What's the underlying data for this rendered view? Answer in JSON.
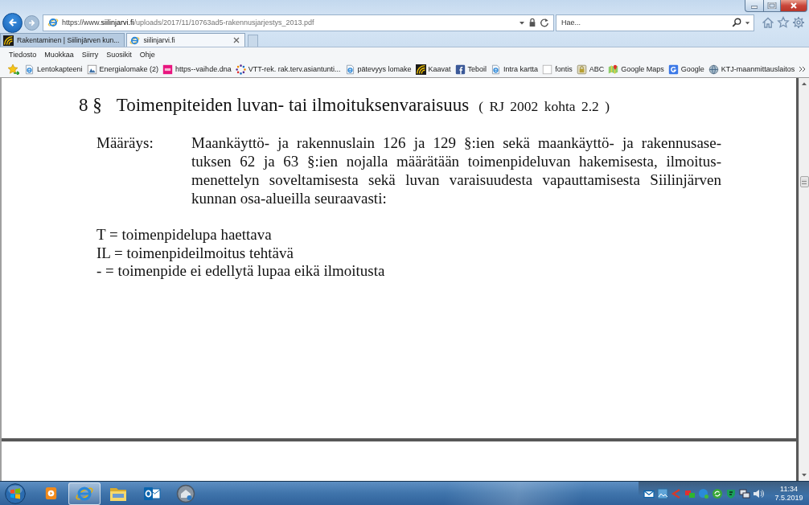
{
  "address_bar": {
    "prefix": "https://www.",
    "domain": "siilinjarvi.fi",
    "path": "/uploads/2017/11/10763ad5-rakennusjarjestys_2013.pdf"
  },
  "search": {
    "placeholder": "Hae..."
  },
  "tabs": [
    {
      "label": "Rakentaminen | Siilinjärven kun...",
      "selected": false
    },
    {
      "label": "siilinjarvi.fi",
      "selected": true
    }
  ],
  "menu": [
    "Tiedosto",
    "Muokkaa",
    "Siirry",
    "Suosikit",
    "Ohje"
  ],
  "favorites": [
    "Lentokapteeni",
    "Energialomake (2)",
    "https--vaihde.dna",
    "VTT-rek. rak.terv.asiantunti...",
    "pätevyys lomake",
    "Kaavat",
    "Teboil",
    "Intra kartta",
    "fontis",
    "ABC",
    "Google Maps",
    "Google",
    "KTJ-maanmittauslaitos"
  ],
  "document": {
    "section_number": "8 §",
    "title": "Toimenpiteiden luvan- tai ilmoituksenvaraisuus",
    "reference": "( RJ 2002 kohta 2.2 )",
    "regulation": {
      "label": "Määräys:",
      "lines": [
        "Maankäyttö- ja rakennuslain 126 ja 129 §:ien sekä maankäyttö- ja rakennusase-",
        "tuksen 62 ja 63 §:ien nojalla määrätään toimenpideluvan hakemisesta, ilmoitus-",
        "menettelyn soveltamisesta sekä luvan varaisuudesta vapauttamisesta Siilinjärven",
        "kunnan osa-alueilla seuraavasti:"
      ]
    },
    "definitions": [
      {
        "code": "T",
        "meaning": "= toimenpidelupa haettava"
      },
      {
        "code": "IL",
        "meaning": "= toimenpideilmoitus tehtävä"
      },
      {
        "code": "-",
        "meaning": "= toimenpide ei edellytä lupaa eikä ilmoitusta"
      }
    ]
  },
  "taskbar": {
    "apps": [
      {
        "running": false
      },
      {
        "running": true
      },
      {
        "running": false
      },
      {
        "running": false
      },
      {
        "running": false
      }
    ],
    "clock": {
      "time": "11:34",
      "date": "7.5.2019"
    }
  }
}
